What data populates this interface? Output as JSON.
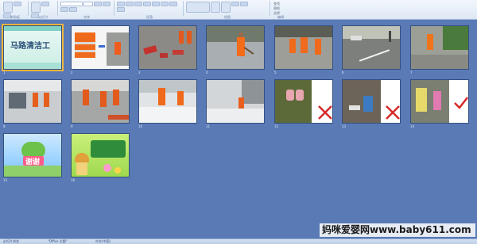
{
  "ribbon": {
    "groups": [
      {
        "label": "剪贴板"
      },
      {
        "label": "幻灯片"
      },
      {
        "label": "字体"
      },
      {
        "label": "段落"
      },
      {
        "label": "绘图"
      },
      {
        "label": "编辑"
      }
    ],
    "find_label": "查找",
    "replace_label": "替换",
    "select_label": "选择",
    "new_slide_label": "新建幻灯片"
  },
  "slides": [
    {
      "num": "1",
      "title": "马路清洁工"
    },
    {
      "num": "2"
    },
    {
      "num": "3"
    },
    {
      "num": "4"
    },
    {
      "num": "5"
    },
    {
      "num": "6"
    },
    {
      "num": "7"
    },
    {
      "num": "8"
    },
    {
      "num": "9"
    },
    {
      "num": "10"
    },
    {
      "num": "11"
    },
    {
      "num": "12"
    },
    {
      "num": "13"
    },
    {
      "num": "14"
    },
    {
      "num": "15",
      "text": "谢谢"
    },
    {
      "num": "16"
    }
  ],
  "statusbar": {
    "left": "幻灯片浏览",
    "theme": "\"Office 主题\"",
    "lang": "中文(中国)"
  },
  "watermark": "妈咪爱婴网www.baby611.com",
  "colors": {
    "background": "#5a7ab6",
    "selection": "#f3b53d",
    "check_mark": "#d62a2a"
  }
}
